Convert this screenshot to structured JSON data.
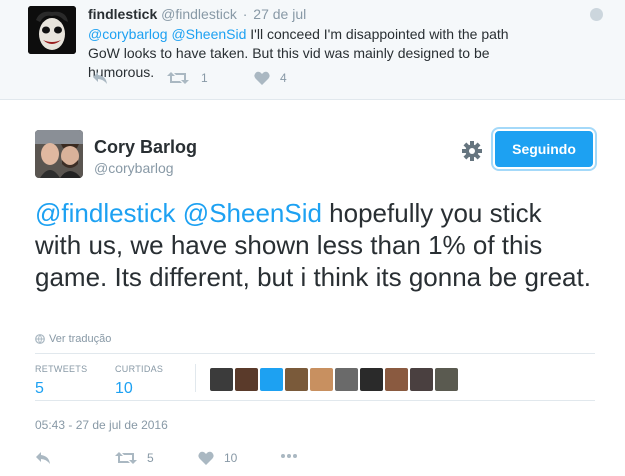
{
  "reply_tweet": {
    "name": "findlestick",
    "handle": "@findlestick",
    "separator": "·",
    "time": "27 de jul",
    "mentions": [
      "@corybarlog",
      "@SheenSid"
    ],
    "text_rest": " I'll conceed I'm disappointed with the path GoW looks to have taken. But this vid was mainly designed to be humorous.",
    "retweets": "1",
    "likes": "4"
  },
  "main_tweet": {
    "name": "Cory Barlog",
    "handle": "@corybarlog",
    "follow_label": "Seguindo",
    "mentions": [
      "@findlestick",
      "@SheenSid"
    ],
    "text_rest": " hopefully you stick with us, we have shown less than 1% of this game. Its different, but i think its gonna be great.",
    "translate_label": "Ver tradução",
    "retweets_label": "RETWEETS",
    "retweets_value": "5",
    "likes_label": "CURTIDAS",
    "likes_value": "10",
    "timestamp": "05:43 - 27 de jul de 2016",
    "action_retweets": "5",
    "action_likes": "10"
  },
  "colors": {
    "accent": "#1da1f2",
    "muted": "#8899a6",
    "like_heart": "#aab8c2"
  },
  "icons": [
    "reply-icon",
    "retweet-icon",
    "heart-icon",
    "more-icon",
    "gear-icon",
    "globe-icon",
    "caret-icon"
  ]
}
